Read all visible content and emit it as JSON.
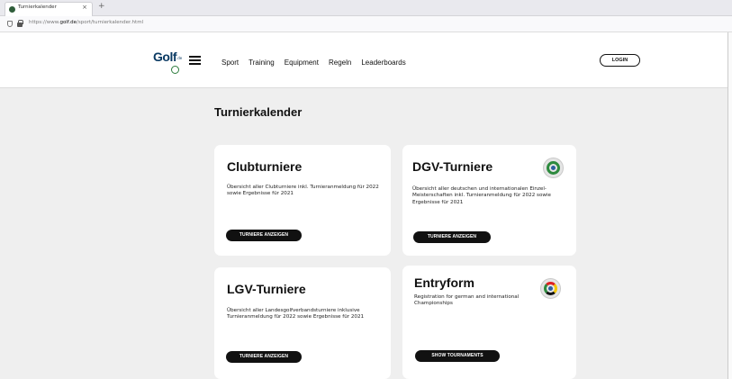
{
  "browser": {
    "tab_title": "Turnierkalender",
    "tab_close": "×",
    "new_tab": "+",
    "url_prefix": "https://www.",
    "url_domain": "golf.de",
    "url_path": "/sport/turnierkalender.html"
  },
  "header": {
    "logo_text": "Golf",
    "logo_sub": ".de",
    "nav": [
      "Sport",
      "Training",
      "Equipment",
      "Regeln",
      "Leaderboards"
    ],
    "login_label": "LOGIN"
  },
  "main": {
    "title": "Turnierkalender",
    "cards": [
      {
        "title": "Clubturniere",
        "description": "Übersicht aller Clubturniere inkl. Turnieranmeldung für 2022 sowie Ergebnisse für 2021",
        "button": "TURNIERE ANZEIGEN"
      },
      {
        "title": "DGV-Turniere",
        "description": "Übersicht aller deutschen und internationalen Einzel-Meisterschaften inkl. Turnieranmeldung für 2022 sowie Ergebnisse für 2021",
        "button": "TURNIERE ANZEIGEN",
        "icon": "dgv-emblem-icon"
      },
      {
        "title": "LGV-Turniere",
        "description": "Übersicht aller Landesgolfverbandsturniere inklusive Turnieranmeldung für 2022 sowie Ergebnisse für 2021",
        "button": "TURNIERE ANZEIGEN"
      },
      {
        "title": "Entryform",
        "description": "Registration for german and international Championships",
        "button": "SHOW TOURNAMENTS",
        "icon": "entryform-emblem-icon"
      }
    ]
  },
  "colors": {
    "accent": "#111111",
    "page_bg": "#efefef",
    "card_bg": "#ffffff",
    "logo": "#0a3a63"
  }
}
